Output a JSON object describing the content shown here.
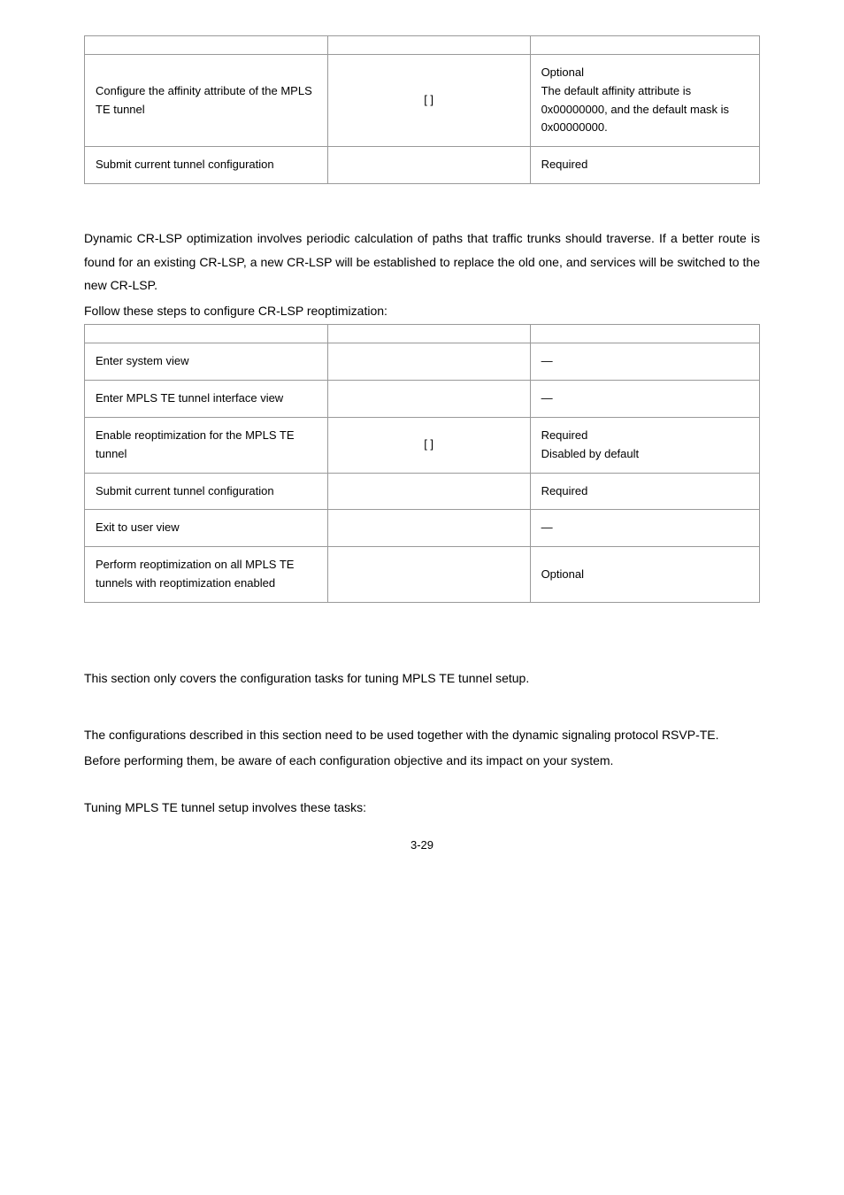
{
  "table1": {
    "rows": [
      {
        "c1": "",
        "c2": "",
        "c3": ""
      },
      {
        "c1": "Configure the affinity attribute of the MPLS TE tunnel",
        "c2": "[               ]",
        "c3": "Optional\nThe default affinity attribute is 0x00000000, and the default mask is 0x00000000."
      },
      {
        "c1": "Submit current tunnel configuration",
        "c2": "",
        "c3": "Required"
      }
    ]
  },
  "intro": {
    "p1": "Dynamic CR-LSP optimization involves periodic calculation of paths that traffic trunks should traverse. If a better route is found for an existing CR-LSP, a new CR-LSP will be established to replace the old one, and services will be switched to the new CR-LSP.",
    "p2": "Follow these steps to configure CR-LSP reoptimization:"
  },
  "table2": {
    "rows": [
      {
        "c1": "",
        "c2": "",
        "c3": ""
      },
      {
        "c1": "Enter system view",
        "c2": "",
        "c3": "—"
      },
      {
        "c1": "Enter MPLS TE tunnel interface view",
        "c2": "",
        "c3": "—"
      },
      {
        "c1": "Enable reoptimization for the MPLS TE tunnel",
        "c2": "[               ]",
        "c3": "Required\nDisabled by default"
      },
      {
        "c1": "Submit current tunnel configuration",
        "c2": "",
        "c3": "Required"
      },
      {
        "c1": "Exit to user view",
        "c2": "",
        "c3": "—"
      },
      {
        "c1": "Perform reoptimization on all MPLS TE tunnels with reoptimization enabled",
        "c2": "",
        "c3": "Optional"
      }
    ]
  },
  "section2": {
    "p1": "This section only covers the configuration tasks for tuning MPLS TE tunnel setup.",
    "p2": "The configurations described in this section need to be used together with the dynamic signaling protocol RSVP-TE.",
    "p3": "Before performing them, be aware of each configuration objective and its impact on your system.",
    "p4": "Tuning MPLS TE tunnel setup involves these tasks:"
  },
  "pagenum": "3-29"
}
